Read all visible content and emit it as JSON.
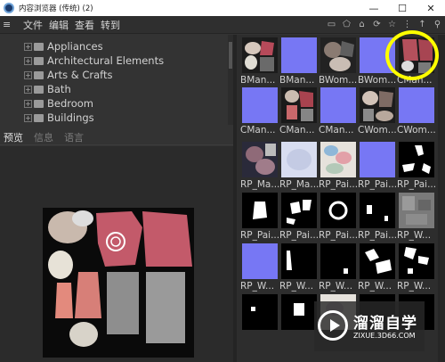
{
  "window": {
    "title": "内容浏览器 (传统)  (2)",
    "minimize": "—",
    "maximize": "☐",
    "close": "✕"
  },
  "menu": {
    "hamburger": "≡",
    "items": [
      "文件",
      "编辑",
      "查看",
      "转到"
    ],
    "tools": [
      "▭",
      "⬠",
      "⌂",
      "⟳",
      "☆",
      "⋮",
      "↑",
      "⚲"
    ]
  },
  "tree": {
    "items": [
      {
        "label": "Appliances"
      },
      {
        "label": "Architectural Elements"
      },
      {
        "label": "Arts & Crafts"
      },
      {
        "label": "Bath"
      },
      {
        "label": "Bedroom"
      },
      {
        "label": "Buildings"
      }
    ],
    "expander": "+"
  },
  "preview_tabs": [
    "预览",
    "信息",
    "语言"
  ],
  "grid": {
    "items": [
      {
        "caption": "BMan...",
        "kind": "clothes"
      },
      {
        "caption": "BMan...",
        "kind": "normal"
      },
      {
        "caption": "BWom...",
        "kind": "clothes2"
      },
      {
        "caption": "BWom...",
        "kind": "normal"
      },
      {
        "caption": "CMan...",
        "kind": "clothes_red"
      },
      {
        "caption": "CMan...",
        "kind": "normal"
      },
      {
        "caption": "CMan...",
        "kind": "clothes_red2"
      },
      {
        "caption": "CMan...",
        "kind": "normal"
      },
      {
        "caption": "CWom...",
        "kind": "clothes3"
      },
      {
        "caption": "CWom...",
        "kind": "normal"
      },
      {
        "caption": "RP_Ma...",
        "kind": "clothes4"
      },
      {
        "caption": "RP_Ma...",
        "kind": "light"
      },
      {
        "caption": "RP_Pai...",
        "kind": "light2"
      },
      {
        "caption": "RP_Pai...",
        "kind": "normal"
      },
      {
        "caption": "RP_Pai...",
        "kind": "mask1"
      },
      {
        "caption": "RP_Pai...",
        "kind": "mask2"
      },
      {
        "caption": "RP_Pai...",
        "kind": "mask3"
      },
      {
        "caption": "RP_Pai...",
        "kind": "mask4"
      },
      {
        "caption": "RP_Pai...",
        "kind": "mask5"
      },
      {
        "caption": "RP_W...",
        "kind": "gray"
      },
      {
        "caption": "RP_W...",
        "kind": "normal"
      },
      {
        "caption": "RP_W...",
        "kind": "mask6"
      },
      {
        "caption": "RP_W...",
        "kind": "mask7"
      },
      {
        "caption": "RP_W...",
        "kind": "mask8"
      },
      {
        "caption": "RP_W...",
        "kind": "mask9"
      },
      {
        "caption": "",
        "kind": "mask10"
      },
      {
        "caption": "",
        "kind": "mask11"
      },
      {
        "caption": "",
        "kind": "clothes5"
      },
      {
        "caption": "",
        "kind": "mask12"
      },
      {
        "caption": "",
        "kind": "mask13"
      }
    ]
  },
  "watermark": {
    "title": "溜溜自学",
    "url": "ZIXUE.3D66.COM"
  },
  "colors": {
    "highlight": "#ffff00",
    "normal_map": "#7777f4"
  }
}
